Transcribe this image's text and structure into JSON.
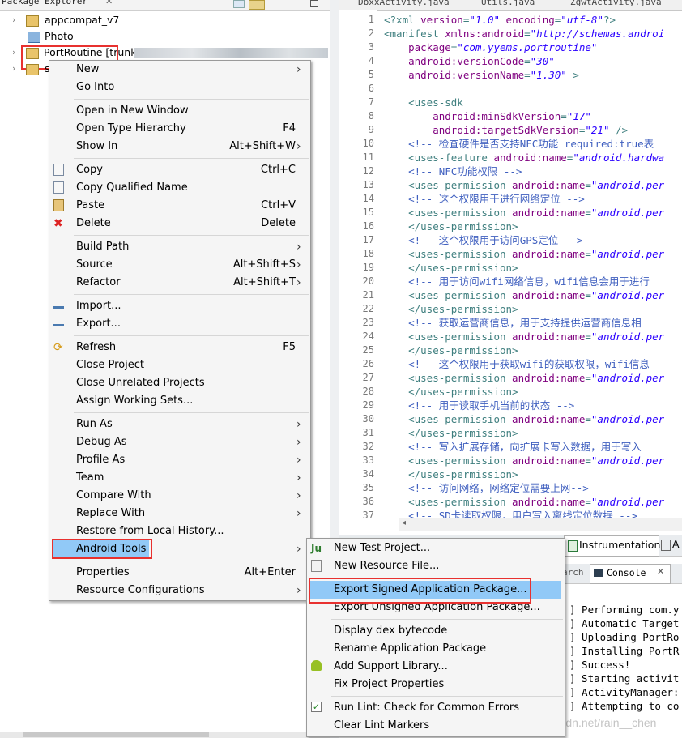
{
  "package_explorer": {
    "tab_title": "Package Explorer",
    "tree": [
      {
        "label": "appcompat_v7"
      },
      {
        "label": "Photo"
      },
      {
        "label": "PortRoutine [trunk/"
      },
      {
        "label": "s"
      }
    ]
  },
  "editor": {
    "tabs": [
      "DbxxActivity.java",
      "Utils.java",
      "ZgwtActivity.java"
    ],
    "lines": [
      {
        "n": "1",
        "parts": [
          [
            "tag",
            "<?xml "
          ],
          [
            "attr",
            "version"
          ],
          [
            "tag",
            "="
          ],
          [
            "val",
            "\"1.0\""
          ],
          [
            "tag",
            " "
          ],
          [
            "attr",
            "encoding"
          ],
          [
            "tag",
            "="
          ],
          [
            "val",
            "\"utf-8\""
          ],
          [
            "tag",
            "?>"
          ]
        ]
      },
      {
        "n": "2",
        "parts": [
          [
            "tag",
            "<manifest "
          ],
          [
            "attr",
            "xmlns:android"
          ],
          [
            "tag",
            "="
          ],
          [
            "val",
            "\"http://schemas.androi"
          ]
        ]
      },
      {
        "n": "3",
        "parts": [
          [
            "tag",
            "    "
          ],
          [
            "attr",
            "package"
          ],
          [
            "tag",
            "="
          ],
          [
            "val",
            "\"com.yyems.portroutine\""
          ]
        ]
      },
      {
        "n": "4",
        "parts": [
          [
            "tag",
            "    "
          ],
          [
            "attr",
            "android:versionCode"
          ],
          [
            "tag",
            "="
          ],
          [
            "val",
            "\"30\""
          ]
        ]
      },
      {
        "n": "5",
        "parts": [
          [
            "tag",
            "    "
          ],
          [
            "attr",
            "android:versionName"
          ],
          [
            "tag",
            "="
          ],
          [
            "val",
            "\"1.30\""
          ],
          [
            "tag",
            " >"
          ]
        ]
      },
      {
        "n": "6",
        "parts": []
      },
      {
        "n": "7",
        "parts": [
          [
            "tag",
            "    <uses-sdk"
          ]
        ]
      },
      {
        "n": "8",
        "parts": [
          [
            "tag",
            "        "
          ],
          [
            "attr",
            "android:minSdkVersion"
          ],
          [
            "tag",
            "="
          ],
          [
            "val",
            "\"17\""
          ]
        ]
      },
      {
        "n": "9",
        "parts": [
          [
            "tag",
            "        "
          ],
          [
            "attr",
            "android:targetSdkVersion"
          ],
          [
            "tag",
            "="
          ],
          [
            "val",
            "\"21\""
          ],
          [
            "tag",
            " />"
          ]
        ]
      },
      {
        "n": "10",
        "parts": [
          [
            "com",
            "    <!-- 检查硬件是否支持NFC功能 required:true表"
          ]
        ]
      },
      {
        "n": "11",
        "parts": [
          [
            "tag",
            "    <uses-feature "
          ],
          [
            "attr",
            "android:name"
          ],
          [
            "tag",
            "="
          ],
          [
            "val",
            "\"android.hardwa"
          ]
        ]
      },
      {
        "n": "12",
        "parts": [
          [
            "com",
            "    <!-- NFC功能权限 -->"
          ]
        ]
      },
      {
        "n": "13",
        "parts": [
          [
            "tag",
            "    <uses-permission "
          ],
          [
            "attr",
            "android:name"
          ],
          [
            "tag",
            "="
          ],
          [
            "val",
            "\"android.per"
          ]
        ]
      },
      {
        "n": "14",
        "parts": [
          [
            "com",
            "    <!-- 这个权限用于进行网络定位 -->"
          ]
        ]
      },
      {
        "n": "15",
        "parts": [
          [
            "tag",
            "    <uses-permission "
          ],
          [
            "attr",
            "android:name"
          ],
          [
            "tag",
            "="
          ],
          [
            "val",
            "\"android.per"
          ]
        ]
      },
      {
        "n": "16",
        "parts": [
          [
            "tag",
            "    </uses-permission>"
          ]
        ]
      },
      {
        "n": "17",
        "parts": [
          [
            "com",
            "    <!-- 这个权限用于访问GPS定位 -->"
          ]
        ]
      },
      {
        "n": "18",
        "parts": [
          [
            "tag",
            "    <uses-permission "
          ],
          [
            "attr",
            "android:name"
          ],
          [
            "tag",
            "="
          ],
          [
            "val",
            "\"android.per"
          ]
        ]
      },
      {
        "n": "19",
        "parts": [
          [
            "tag",
            "    </uses-permission>"
          ]
        ]
      },
      {
        "n": "20",
        "parts": [
          [
            "com",
            "    <!-- 用于访问wifi网络信息，wifi信息会用于进行"
          ]
        ]
      },
      {
        "n": "21",
        "parts": [
          [
            "tag",
            "    <uses-permission "
          ],
          [
            "attr",
            "android:name"
          ],
          [
            "tag",
            "="
          ],
          [
            "val",
            "\"android.per"
          ]
        ]
      },
      {
        "n": "22",
        "parts": [
          [
            "tag",
            "    </uses-permission>"
          ]
        ]
      },
      {
        "n": "23",
        "parts": [
          [
            "com",
            "    <!-- 获取运营商信息，用于支持提供运营商信息相"
          ]
        ]
      },
      {
        "n": "24",
        "parts": [
          [
            "tag",
            "    <uses-permission "
          ],
          [
            "attr",
            "android:name"
          ],
          [
            "tag",
            "="
          ],
          [
            "val",
            "\"android.per"
          ]
        ]
      },
      {
        "n": "25",
        "parts": [
          [
            "tag",
            "    </uses-permission>"
          ]
        ]
      },
      {
        "n": "26",
        "parts": [
          [
            "com",
            "    <!-- 这个权限用于获取wifi的获取权限，wifi信息"
          ]
        ]
      },
      {
        "n": "27",
        "parts": [
          [
            "tag",
            "    <uses-permission "
          ],
          [
            "attr",
            "android:name"
          ],
          [
            "tag",
            "="
          ],
          [
            "val",
            "\"android.per"
          ]
        ]
      },
      {
        "n": "28",
        "parts": [
          [
            "tag",
            "    </uses-permission>"
          ]
        ]
      },
      {
        "n": "29",
        "parts": [
          [
            "com",
            "    <!-- 用于读取手机当前的状态 -->"
          ]
        ]
      },
      {
        "n": "30",
        "parts": [
          [
            "tag",
            "    <uses-permission "
          ],
          [
            "attr",
            "android:name"
          ],
          [
            "tag",
            "="
          ],
          [
            "val",
            "\"android.per"
          ]
        ]
      },
      {
        "n": "31",
        "parts": [
          [
            "tag",
            "    </uses-permission>"
          ]
        ]
      },
      {
        "n": "32",
        "parts": [
          [
            "com",
            "    <!-- 写入扩展存储，向扩展卡写入数据，用于写入"
          ]
        ]
      },
      {
        "n": "33",
        "parts": [
          [
            "tag",
            "    <uses-permission "
          ],
          [
            "attr",
            "android:name"
          ],
          [
            "tag",
            "="
          ],
          [
            "val",
            "\"android.per"
          ]
        ]
      },
      {
        "n": "34",
        "parts": [
          [
            "tag",
            "    </uses-permission>"
          ]
        ]
      },
      {
        "n": "35",
        "parts": [
          [
            "com",
            "    <!-- 访问网络，网络定位需要上网-->"
          ]
        ]
      },
      {
        "n": "36",
        "parts": [
          [
            "tag",
            "    <uses-permission "
          ],
          [
            "attr",
            "android:name"
          ],
          [
            "tag",
            "="
          ],
          [
            "val",
            "\"android.per"
          ]
        ]
      },
      {
        "n": "37",
        "parts": [
          [
            "com",
            "    <!-- SD卡读取权限，用户写入离线定位数据 -->"
          ]
        ]
      }
    ]
  },
  "bottom_panel": {
    "tabs": [
      "Instrumentation",
      "A"
    ],
    "tabs2": [
      "arch",
      "Console"
    ],
    "console_lines": [
      "] Performing com.y",
      "] Automatic Target",
      "] Uploading PortRo",
      "] Installing PortR",
      "] Success!",
      "] Starting activit",
      "] ActivityManager:",
      "] Attempting to co"
    ]
  },
  "context_menu": {
    "items": [
      {
        "label": "New",
        "arrow": true
      },
      {
        "label": "Go Into"
      },
      {
        "sep": true
      },
      {
        "label": "Open in New Window"
      },
      {
        "label": "Open Type Hierarchy",
        "shortcut": "F4"
      },
      {
        "label": "Show In",
        "shortcut": "Alt+Shift+W",
        "arrow": true
      },
      {
        "sep": true
      },
      {
        "label": "Copy",
        "shortcut": "Ctrl+C",
        "icon": "copy"
      },
      {
        "label": "Copy Qualified Name",
        "icon": "copy"
      },
      {
        "label": "Paste",
        "shortcut": "Ctrl+V",
        "icon": "paste"
      },
      {
        "label": "Delete",
        "shortcut": "Delete",
        "icon": "delete"
      },
      {
        "sep": true
      },
      {
        "label": "Build Path",
        "arrow": true
      },
      {
        "label": "Source",
        "shortcut": "Alt+Shift+S",
        "arrow": true
      },
      {
        "label": "Refactor",
        "shortcut": "Alt+Shift+T",
        "arrow": true
      },
      {
        "sep": true
      },
      {
        "label": "Import...",
        "icon": "import"
      },
      {
        "label": "Export...",
        "icon": "export"
      },
      {
        "sep": true
      },
      {
        "label": "Refresh",
        "shortcut": "F5",
        "icon": "refresh"
      },
      {
        "label": "Close Project"
      },
      {
        "label": "Close Unrelated Projects"
      },
      {
        "label": "Assign Working Sets..."
      },
      {
        "sep": true
      },
      {
        "label": "Run As",
        "arrow": true
      },
      {
        "label": "Debug As",
        "arrow": true
      },
      {
        "label": "Profile As",
        "arrow": true
      },
      {
        "label": "Team",
        "arrow": true
      },
      {
        "label": "Compare With",
        "arrow": true
      },
      {
        "label": "Replace With",
        "arrow": true
      },
      {
        "label": "Restore from Local History..."
      },
      {
        "label": "Android Tools",
        "arrow": true,
        "highlighted": true
      },
      {
        "sep": true
      },
      {
        "label": "Properties",
        "shortcut": "Alt+Enter"
      },
      {
        "label": "Resource Configurations",
        "arrow": true
      }
    ]
  },
  "submenu": {
    "items": [
      {
        "label": "New Test Project...",
        "icon": "test"
      },
      {
        "label": "New Resource File...",
        "icon": "resource"
      },
      {
        "sep": true
      },
      {
        "label": "Export Signed Application Package...",
        "highlighted": true
      },
      {
        "label": "Export Unsigned Application Package..."
      },
      {
        "sep": true
      },
      {
        "label": "Display dex bytecode"
      },
      {
        "label": "Rename Application Package"
      },
      {
        "label": "Add Support Library...",
        "icon": "android"
      },
      {
        "label": "Fix Project Properties"
      },
      {
        "sep": true
      },
      {
        "label": "Run Lint: Check for Common Errors",
        "icon": "check"
      },
      {
        "label": "Clear Lint Markers"
      }
    ]
  },
  "watermark": "https://blog.csdn.net/rain__chen",
  "colors": {
    "highlight": "#91c9f7",
    "red_box": "#e8312f"
  }
}
